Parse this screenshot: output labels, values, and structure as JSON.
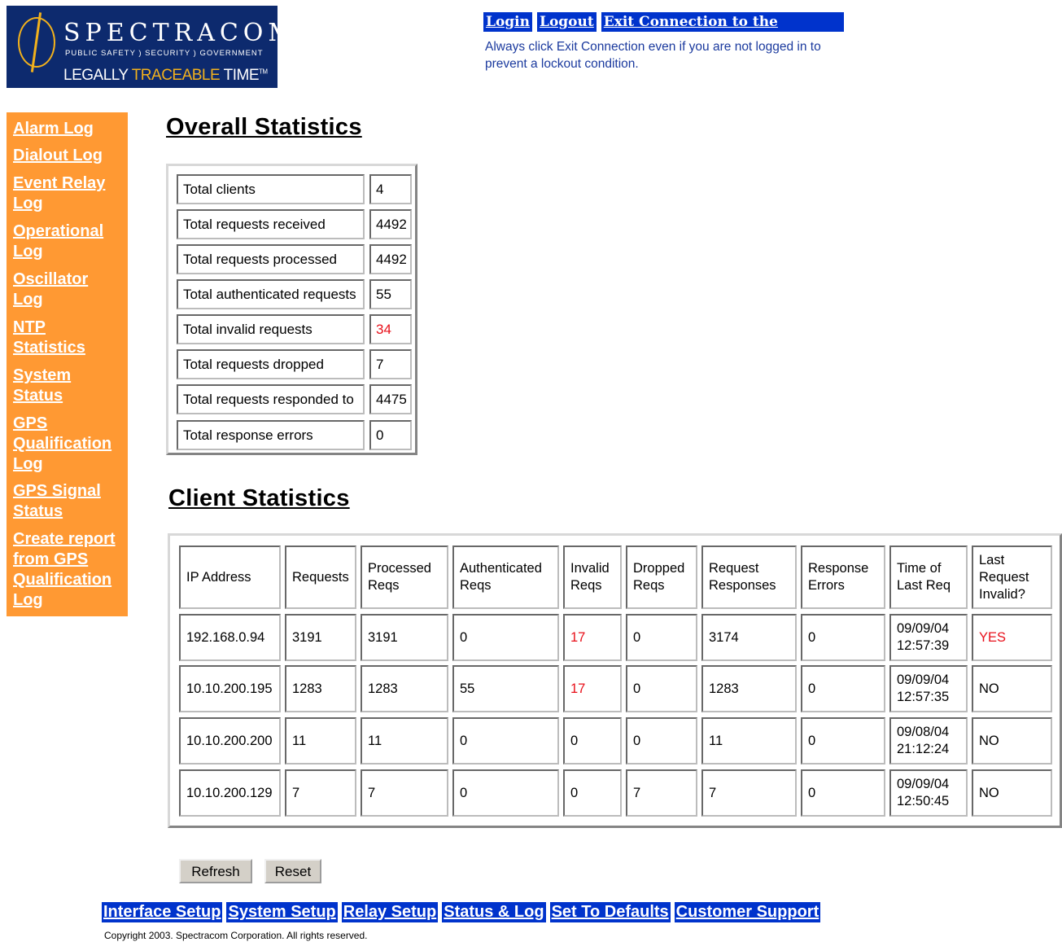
{
  "logo": {
    "brand": "SPECTRACOM",
    "tagline": "PUBLIC SAFETY ) SECURITY ) GOVERNMENT",
    "motto_pre": "LEGALLY ",
    "motto_hl": "TRACEABLE",
    "motto_post": " TIME",
    "tm": "TM"
  },
  "header": {
    "login": "Login",
    "logout": "Logout",
    "exit": "Exit Connection to the Product",
    "notice": "Always click Exit Connection even if you are not logged in to prevent a lockout condition."
  },
  "sidebar": {
    "items": [
      {
        "label": "Alarm Log"
      },
      {
        "label": "Dialout Log"
      },
      {
        "label": "Event Relay Log"
      },
      {
        "label": "Operational Log"
      },
      {
        "label": "Oscillator Log"
      },
      {
        "label": "NTP Statistics"
      },
      {
        "label": "System Status"
      },
      {
        "label": "GPS Qualification Log"
      },
      {
        "label": "GPS Signal Status"
      },
      {
        "label": "Create report from GPS Qualification Log"
      }
    ]
  },
  "overall": {
    "title": "Overall Statistics",
    "rows": [
      {
        "label": "Total clients",
        "value": "4"
      },
      {
        "label": "Total requests received",
        "value": "4492"
      },
      {
        "label": "Total requests processed",
        "value": "4492"
      },
      {
        "label": "Total authenticated requests",
        "value": "55"
      },
      {
        "label": "Total invalid requests",
        "value": "34",
        "alert": true
      },
      {
        "label": "Total requests dropped",
        "value": "7"
      },
      {
        "label": "Total requests responded to",
        "value": "4475"
      },
      {
        "label": "Total response errors",
        "value": "0"
      }
    ]
  },
  "client": {
    "title": "Client Statistics",
    "headers": [
      "IP Address",
      "Requests",
      "Processed Reqs",
      "Authenticated Reqs",
      "Invalid Reqs",
      "Dropped Reqs",
      "Request Responses",
      "Response Errors",
      "Time of Last Req",
      "Last Request Invalid?"
    ],
    "rows": [
      {
        "cells": [
          "192.168.0.94",
          "3191",
          "3191",
          "0",
          "17",
          "0",
          "3174",
          "0",
          "09/09/04 12:57:39",
          "YES"
        ],
        "red": [
          4,
          9
        ]
      },
      {
        "cells": [
          "10.10.200.195",
          "1283",
          "1283",
          "55",
          "17",
          "0",
          "1283",
          "0",
          "09/09/04 12:57:35",
          "NO"
        ],
        "red": [
          4
        ]
      },
      {
        "cells": [
          "10.10.200.200",
          "11",
          "11",
          "0",
          "0",
          "0",
          "11",
          "0",
          "09/08/04 21:12:24",
          "NO"
        ],
        "red": []
      },
      {
        "cells": [
          "10.10.200.129",
          "7",
          "7",
          "0",
          "0",
          "7",
          "7",
          "0",
          "09/09/04 12:50:45",
          "NO"
        ],
        "red": []
      }
    ]
  },
  "buttons": {
    "refresh": "Refresh",
    "reset": "Reset"
  },
  "bottom_nav": [
    "Interface Setup",
    "System Setup",
    "Relay Setup",
    "Status & Log",
    "Set To Defaults",
    "Customer Support"
  ],
  "copyright": "Copyright 2003. Spectracom Corporation. All rights reserved.",
  "colors": {
    "sidebar": "#ff9933",
    "link_bg": "#0033cc",
    "alert": "#e8101a"
  }
}
